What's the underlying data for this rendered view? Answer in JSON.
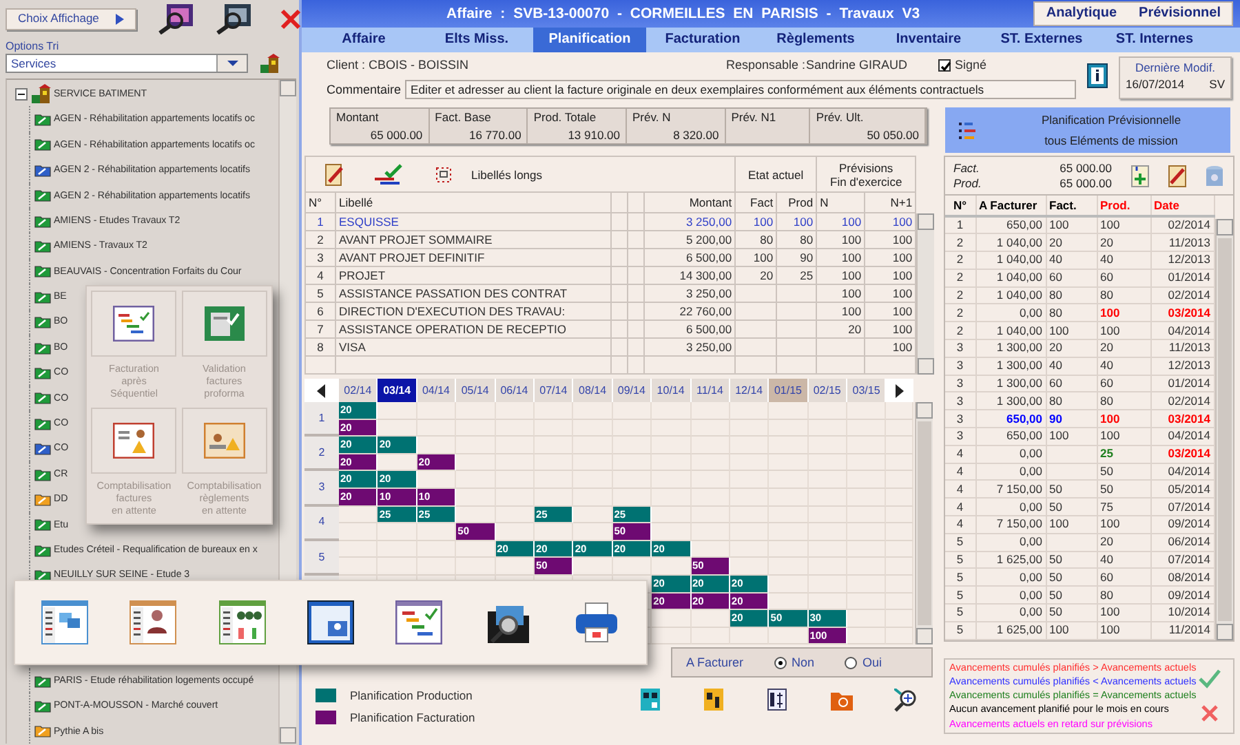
{
  "sidebar": {
    "display_button": "Choix Affichage",
    "sort_label": "Options Tri",
    "sort_select": "Services",
    "tree": {
      "label": "SERVICE BATIMENT",
      "expanded": true,
      "children": [
        {
          "label": "AGEN - Réhabilitation appartements locatifs oc",
          "color": "#1f9a3a"
        },
        {
          "label": "AGEN - Réhabilitation appartements locatifs oc",
          "color": "#1f9a3a"
        },
        {
          "label": "AGEN 2 - Réhabilitation appartements locatifs",
          "color": "#2f5fc8"
        },
        {
          "label": "AGEN 2 - Réhabilitation appartements locatifs",
          "color": "#1f9a3a"
        },
        {
          "label": "AMIENS - Etudes Travaux T2",
          "color": "#1f9a3a"
        },
        {
          "label": "AMIENS - Travaux T2",
          "color": "#1f9a3a"
        },
        {
          "label": "BEAUVAIS - Concentration Forfaits du Cour",
          "color": "#1f9a3a"
        },
        {
          "label": "BE",
          "color": "#1f9a3a"
        },
        {
          "label": "BO",
          "color": "#1f9a3a"
        },
        {
          "label": "BO",
          "color": "#1f9a3a"
        },
        {
          "label": "CO",
          "color": "#1f9a3a"
        },
        {
          "label": "CO",
          "color": "#1f9a3a"
        },
        {
          "label": "CO",
          "color": "#1f9a3a"
        },
        {
          "label": "CO",
          "color": "#2f5fc8"
        },
        {
          "label": "CR",
          "color": "#1f9a3a"
        },
        {
          "label": "DD",
          "color": "#f0a020"
        },
        {
          "label": "Etu",
          "color": "#1f9a3a"
        },
        {
          "label": "Etudes Créteil - Requalification de bureaux en x",
          "color": "#1f9a3a"
        },
        {
          "label": "NEUILLY SUR SEINE - Etude 3",
          "color": "#1f9a3a"
        }
      ]
    },
    "tree_bottom": [
      {
        "label": "PARIS - Etude réhabilitation logements occupé",
        "color": "#1f9a3a"
      },
      {
        "label": "PONT-A-MOUSSON - Marché couvert",
        "color": "#1f9a3a"
      },
      {
        "label": "Pythie A bis",
        "color": "#f0a020"
      }
    ]
  },
  "popup_tiles": [
    {
      "label": "Facturation\naprès\nSéquentiel",
      "disabled": true
    },
    {
      "label": "Validation\nfactures\nproforma",
      "disabled": true
    },
    {
      "label": "Comptabilisation\nfactures\nen attente",
      "disabled": true
    },
    {
      "label": "Comptabilisation\nrèglements\nen attente",
      "disabled": true
    }
  ],
  "header": {
    "title": "Affaire : SVB-13-00070 - CORMEILLES EN PARISIS - Travaux V3",
    "buttons": [
      "Analytique",
      "Prévisionnel"
    ]
  },
  "tabs": [
    {
      "label": "Affaire",
      "selected": false
    },
    {
      "label": "Elts Miss.",
      "selected": false
    },
    {
      "label": "Planification",
      "selected": true
    },
    {
      "label": "Facturation",
      "selected": false
    },
    {
      "label": "Règlements",
      "selected": false
    },
    {
      "label": "Inventaire",
      "selected": false
    },
    {
      "label": "ST. Externes",
      "selected": false
    },
    {
      "label": "ST. Internes",
      "selected": false
    }
  ],
  "info": {
    "client": "Client : CBOIS - BOISSIN",
    "responsable_label": "Responsable :",
    "responsable": "Sandrine GIRAUD",
    "signed": {
      "label": "Signé",
      "checked": true
    },
    "comment_label": "Commentaire",
    "comment": "Editer et adresser au client la facture originale en deux exemplaires conformément aux éléments contractuels",
    "last_modified": {
      "label": "Dernière Modif.",
      "date": "16/07/2014",
      "user": "SV"
    }
  },
  "summary": [
    {
      "label": "Montant",
      "value": "65 000.00"
    },
    {
      "label": "Fact. Base",
      "value": "16 770.00"
    },
    {
      "label": "Prod. Totale",
      "value": "13 910.00"
    },
    {
      "label": "Prév. N",
      "value": "8 320.00"
    },
    {
      "label": "Prév. N1"
    },
    {
      "label": "Prév. Ult.",
      "value": "50 050.00"
    }
  ],
  "planning_box": {
    "line_1": "Planification Prévisionnelle",
    "line_2": "tous Eléments de mission"
  },
  "elements_table": {
    "toolbar_label": "Libellés longs",
    "group_headers": [
      "Etat actuel",
      "Prévisions\nFin d'exercice"
    ],
    "columns": [
      "N°",
      "Libellé",
      "Montant",
      "Fact",
      "Prod",
      "N",
      "N+1"
    ],
    "rows": [
      {
        "n": "1",
        "label": "ESQUISSE",
        "amount": "3 250,00",
        "fact": "100",
        "prod": "100",
        "n_value": "100",
        "n1": "100",
        "selected": true
      },
      {
        "n": "2",
        "label": "AVANT PROJET SOMMAIRE",
        "amount": "5 200,00",
        "fact": "80",
        "prod": "80",
        "n_value": "100",
        "n1": "100",
        "selected": false
      },
      {
        "n": "3",
        "label": "AVANT PROJET DEFINITIF",
        "amount": "6 500,00",
        "fact": "100",
        "prod": "90",
        "n_value": "100",
        "n1": "100",
        "selected": false
      },
      {
        "n": "4",
        "label": "PROJET",
        "amount": "14 300,00",
        "fact": "20",
        "prod": "25",
        "n_value": "100",
        "n1": "100",
        "selected": false
      },
      {
        "n": "5",
        "label": "ASSISTANCE PASSATION DES CONTRAT",
        "amount": "3 250,00",
        "n_value": "100",
        "n1": "100",
        "selected": false
      },
      {
        "n": "6",
        "label": "DIRECTION D'EXECUTION DES TRAVAU:",
        "amount": "22 760,00",
        "n_value": "100",
        "n1": "100",
        "selected": false
      },
      {
        "n": "7",
        "label": "ASSISTANCE OPERATION DE RECEPTIO",
        "amount": "6 500,00",
        "n_value": "20",
        "n1": "100",
        "selected": false
      },
      {
        "n": "8",
        "label": "VISA",
        "amount": "3 250,00",
        "n1": "100",
        "selected": false
      }
    ]
  },
  "gantt": {
    "months": [
      {
        "label": "02/14",
        "selected": false,
        "marked": false
      },
      {
        "label": "03/14",
        "selected": true,
        "marked": false
      },
      {
        "label": "04/14",
        "selected": false,
        "marked": false
      },
      {
        "label": "05/14",
        "selected": false,
        "marked": false
      },
      {
        "label": "06/14",
        "selected": false,
        "marked": false
      },
      {
        "label": "07/14",
        "selected": false,
        "marked": false
      },
      {
        "label": "08/14",
        "selected": false,
        "marked": false
      },
      {
        "label": "09/14",
        "selected": false,
        "marked": false
      },
      {
        "label": "10/14",
        "selected": false,
        "marked": false
      },
      {
        "label": "11/14",
        "selected": false,
        "marked": false
      },
      {
        "label": "12/14",
        "selected": false,
        "marked": false
      },
      {
        "label": "01/15",
        "selected": false,
        "marked": true
      },
      {
        "label": "02/15",
        "selected": false,
        "marked": false
      },
      {
        "label": "03/15",
        "selected": false,
        "marked": false
      }
    ],
    "rows": [
      {
        "number": "1",
        "cells": [
          {
            "kind": "both",
            "production": "20",
            "billing": "20"
          },
          {
            "kind": "empty"
          },
          {
            "kind": "empty"
          },
          {
            "kind": "empty"
          },
          {
            "kind": "empty"
          },
          {
            "kind": "empty"
          },
          {
            "kind": "empty"
          },
          {
            "kind": "empty"
          },
          {
            "kind": "empty"
          },
          {
            "kind": "empty"
          },
          {
            "kind": "empty"
          },
          {
            "kind": "empty"
          },
          {
            "kind": "empty"
          },
          {
            "kind": "empty"
          }
        ]
      },
      {
        "number": "2",
        "cells": [
          {
            "kind": "both",
            "production": "20",
            "billing": "20"
          },
          {
            "kind": "production",
            "production": "20"
          },
          {
            "kind": "billing",
            "billing": "20"
          },
          {
            "kind": "empty"
          },
          {
            "kind": "empty"
          },
          {
            "kind": "empty"
          },
          {
            "kind": "empty"
          },
          {
            "kind": "empty"
          },
          {
            "kind": "empty"
          },
          {
            "kind": "empty"
          },
          {
            "kind": "empty"
          },
          {
            "kind": "empty"
          },
          {
            "kind": "empty"
          },
          {
            "kind": "empty"
          }
        ]
      },
      {
        "number": "3",
        "cells": [
          {
            "kind": "both",
            "production": "20",
            "billing": "20"
          },
          {
            "kind": "both",
            "production": "20",
            "billing": "10"
          },
          {
            "kind": "billing",
            "billing": "10"
          },
          {
            "kind": "empty"
          },
          {
            "kind": "empty"
          },
          {
            "kind": "empty"
          },
          {
            "kind": "empty"
          },
          {
            "kind": "empty"
          },
          {
            "kind": "empty"
          },
          {
            "kind": "empty"
          },
          {
            "kind": "empty"
          },
          {
            "kind": "empty"
          },
          {
            "kind": "empty"
          },
          {
            "kind": "empty"
          }
        ]
      },
      {
        "number": "4",
        "cells": [
          {
            "kind": "empty"
          },
          {
            "kind": "production",
            "production": "25"
          },
          {
            "kind": "production",
            "production": "25"
          },
          {
            "kind": "billing",
            "billing": "50"
          },
          {
            "kind": "empty"
          },
          {
            "kind": "production",
            "production": "25"
          },
          {
            "kind": "empty"
          },
          {
            "kind": "both",
            "production": "25",
            "billing": "50"
          },
          {
            "kind": "empty"
          },
          {
            "kind": "empty"
          },
          {
            "kind": "empty"
          },
          {
            "kind": "empty"
          },
          {
            "kind": "empty"
          },
          {
            "kind": "empty"
          }
        ]
      },
      {
        "number": "5",
        "cells": [
          {
            "kind": "empty"
          },
          {
            "kind": "empty"
          },
          {
            "kind": "empty"
          },
          {
            "kind": "empty"
          },
          {
            "kind": "production",
            "production": "20"
          },
          {
            "kind": "both",
            "production": "20",
            "billing": "50"
          },
          {
            "kind": "production",
            "production": "20"
          },
          {
            "kind": "production",
            "production": "20"
          },
          {
            "kind": "production",
            "production": "20"
          },
          {
            "kind": "billing",
            "billing": "50"
          },
          {
            "kind": "empty"
          },
          {
            "kind": "empty"
          },
          {
            "kind": "empty"
          },
          {
            "kind": "empty"
          }
        ]
      },
      {
        "cells": [
          {
            "kind": "empty"
          },
          {
            "kind": "empty"
          },
          {
            "kind": "empty"
          },
          {
            "kind": "empty"
          },
          {
            "kind": "empty"
          },
          {
            "kind": "empty"
          },
          {
            "kind": "empty"
          },
          {
            "kind": "empty"
          },
          {
            "kind": "both",
            "production": "20",
            "billing": "20"
          },
          {
            "kind": "both",
            "production": "20",
            "billing": "20"
          },
          {
            "kind": "both",
            "production": "20",
            "billing": "20"
          },
          {
            "kind": "empty"
          },
          {
            "kind": "empty"
          },
          {
            "kind": "empty"
          }
        ]
      },
      {
        "cells": [
          {
            "kind": "empty"
          },
          {
            "kind": "empty"
          },
          {
            "kind": "empty"
          },
          {
            "kind": "empty"
          },
          {
            "kind": "empty"
          },
          {
            "kind": "empty"
          },
          {
            "kind": "empty"
          },
          {
            "kind": "empty"
          },
          {
            "kind": "empty"
          },
          {
            "kind": "empty"
          },
          {
            "kind": "production",
            "production": "20"
          },
          {
            "kind": "production",
            "production": "50"
          },
          {
            "kind": "both",
            "production": "30",
            "billing": "100"
          },
          {
            "kind": "empty"
          }
        ]
      }
    ]
  },
  "a_facturer": {
    "label": "A Facturer",
    "options": [
      {
        "label": "Non",
        "selected": true
      },
      {
        "label": "Oui",
        "selected": false
      }
    ]
  },
  "legend": [
    {
      "label": "Planification Production",
      "color": "#007272"
    },
    {
      "label": "Planification Facturation",
      "color": "#6e0a72"
    }
  ],
  "schedule": {
    "fact_label": "Fact.",
    "fact": "65 000.00",
    "prod_label": "Prod.",
    "prod": "65 000.00",
    "columns": [
      {
        "label": "N°",
        "color": "#000000"
      },
      {
        "label": "A Facturer",
        "color": "#000000"
      },
      {
        "label": "Fact.",
        "color": "#000000"
      },
      {
        "label": "Prod.",
        "color": "#ff0000"
      },
      {
        "label": "Date",
        "color": "#ff0000"
      }
    ],
    "rows": [
      {
        "n": "1",
        "a_facturer": "650,00",
        "fact": "100",
        "prod": "100",
        "date": "02/2014"
      },
      {
        "n": "2",
        "a_facturer": "1 040,00",
        "fact": "20",
        "prod": "20",
        "date": "11/2013"
      },
      {
        "n": "2",
        "a_facturer": "1 040,00",
        "fact": "40",
        "prod": "40",
        "date": "12/2013"
      },
      {
        "n": "2",
        "a_facturer": "1 040,00",
        "fact": "60",
        "prod": "60",
        "date": "01/2014"
      },
      {
        "n": "2",
        "a_facturer": "1 040,00",
        "fact": "80",
        "prod": "80",
        "date": "02/2014"
      },
      {
        "n": "2",
        "a_facturer": "0,00",
        "fact": "80",
        "prod": {
          "text": "100",
          "color": "#ff0000"
        },
        "date": {
          "text": "03/2014",
          "color": "#ff0000"
        }
      },
      {
        "n": "2",
        "a_facturer": "1 040,00",
        "fact": "100",
        "prod": "100",
        "date": "04/2014"
      },
      {
        "n": "3",
        "a_facturer": "1 300,00",
        "fact": "20",
        "prod": "20",
        "date": "11/2013"
      },
      {
        "n": "3",
        "a_facturer": "1 300,00",
        "fact": "40",
        "prod": "40",
        "date": "12/2013"
      },
      {
        "n": "3",
        "a_facturer": "1 300,00",
        "fact": "60",
        "prod": "60",
        "date": "01/2014"
      },
      {
        "n": "3",
        "a_facturer": "1 300,00",
        "fact": "80",
        "prod": "80",
        "date": "02/2014"
      },
      {
        "n": "3",
        "a_facturer": {
          "text": "650,00",
          "color": "#0000ff"
        },
        "fact": {
          "text": "90",
          "color": "#0000ff"
        },
        "prod": {
          "text": "100",
          "color": "#ff0000"
        },
        "date": {
          "text": "03/2014",
          "color": "#ff0000"
        }
      },
      {
        "n": "3",
        "a_facturer": "650,00",
        "fact": "100",
        "prod": "100",
        "date": "04/2014"
      },
      {
        "n": "4",
        "a_facturer": "0,00",
        "prod": {
          "text": "25",
          "color": "#208020"
        },
        "date": {
          "text": "03/2014",
          "color": "#ff0000"
        }
      },
      {
        "n": "4",
        "a_facturer": "0,00",
        "prod": "50",
        "date": "04/2014"
      },
      {
        "n": "4",
        "a_facturer": "7 150,00",
        "fact": "50",
        "prod": "50",
        "date": "05/2014"
      },
      {
        "n": "4",
        "a_facturer": "0,00",
        "fact": "50",
        "prod": "75",
        "date": "07/2014"
      },
      {
        "n": "4",
        "a_facturer": "7 150,00",
        "fact": "100",
        "prod": "100",
        "date": "09/2014"
      },
      {
        "n": "5",
        "a_facturer": "0,00",
        "prod": "20",
        "date": "06/2014"
      },
      {
        "n": "5",
        "a_facturer": "1 625,00",
        "fact": "50",
        "prod": "40",
        "date": "07/2014"
      },
      {
        "n": "5",
        "a_facturer": "0,00",
        "fact": "50",
        "prod": "60",
        "date": "08/2014"
      },
      {
        "n": "5",
        "a_facturer": "0,00",
        "fact": "50",
        "prod": "80",
        "date": "09/2014"
      },
      {
        "n": "5",
        "a_facturer": "0,00",
        "fact": "50",
        "prod": "100",
        "date": "10/2014"
      },
      {
        "n": "5",
        "a_facturer": "1 625,00",
        "fact": "100",
        "prod": "100",
        "date": "11/2014"
      }
    ]
  },
  "status_legend": [
    {
      "label": "Avancements cumulés planifiés > Avancements actuels",
      "color": "#ff3030"
    },
    {
      "label": "Avancements cumulés planifiés < Avancements actuels",
      "color": "#3030ff"
    },
    {
      "label": "Avancements cumulés planifiés = Avancements actuels",
      "color": "#208020"
    },
    {
      "label": "Aucun avancement planifié pour le mois en cours",
      "color": "#000000"
    },
    {
      "label": "Avancements actuels en retard sur prévisions",
      "color": "#ff00ff"
    }
  ]
}
